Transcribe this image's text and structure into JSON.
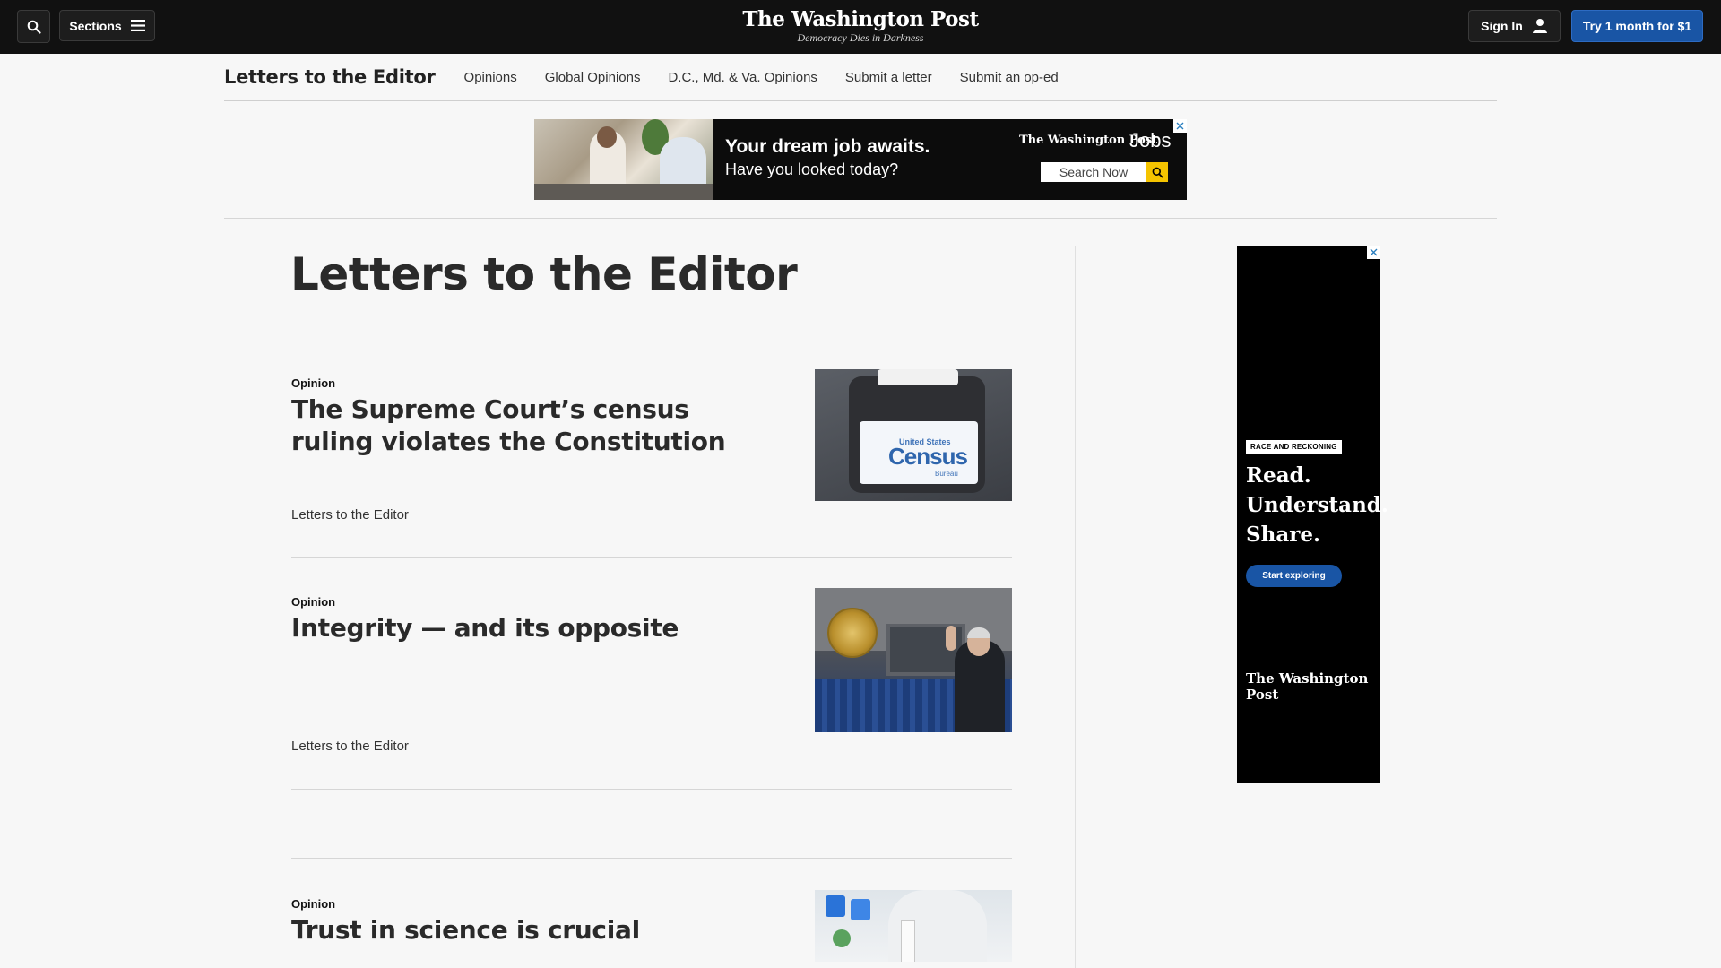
{
  "topbar": {
    "sections_label": "Sections",
    "logo": "The Washington Post",
    "tagline": "Democracy Dies in Darkness",
    "signin_label": "Sign In",
    "try_label": "Try 1 month for $1"
  },
  "section_nav": {
    "title": "Letters to the Editor",
    "links": [
      "Opinions",
      "Global Opinions",
      "D.C., Md. & Va. Opinions",
      "Submit a letter",
      "Submit an op-ed"
    ]
  },
  "top_ad": {
    "headline": "Your dream job awaits.",
    "subline": "Have you looked today?",
    "brand": "The Washington Post",
    "brand_suffix": "Jobs",
    "search_label": "Search Now"
  },
  "page": {
    "title": "Letters to the Editor"
  },
  "articles": [
    {
      "kicker": "Opinion",
      "headline": "The Supreme Court’s census ruling violates the Constitution",
      "byline": "Letters to the Editor",
      "image_text": {
        "top": "United States",
        "main": "Census",
        "bottom": "Bureau"
      }
    },
    {
      "kicker": "Opinion",
      "headline": "Integrity — and its opposite",
      "byline": "Letters to the Editor"
    },
    {
      "kicker": "Opinion",
      "headline": "Trust in science is crucial"
    }
  ],
  "side_ad": {
    "tag": "RACE AND RECKONING",
    "lines": [
      "Read.",
      "Understand.",
      "Share."
    ],
    "cta": "Start exploring",
    "logo": "The Washington Post"
  },
  "colors": {
    "topbar_bg": "#111111",
    "accent_blue": "#1955a5",
    "page_bg": "#f7f7f7"
  },
  "icons": [
    "search-icon",
    "menu-icon",
    "user-icon",
    "ad-close-icon",
    "magnifier-icon"
  ]
}
